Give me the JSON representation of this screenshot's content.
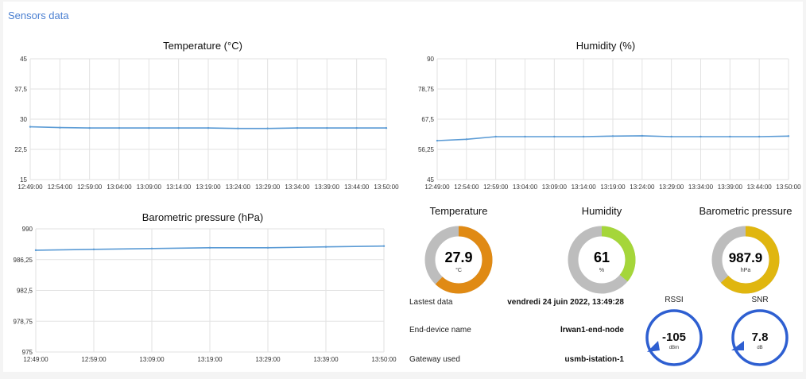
{
  "group_title": "Sensors data",
  "charts": {
    "temperature": {
      "title": "Temperature (°C)",
      "y_ticks": [
        "45",
        "37,5",
        "30",
        "22,5",
        "15"
      ],
      "x_ticks": [
        "12:49:00",
        "12:54:00",
        "12:59:00",
        "13:04:00",
        "13:09:00",
        "13:14:00",
        "13:19:00",
        "13:24:00",
        "13:29:00",
        "13:34:00",
        "13:39:00",
        "13:44:00",
        "13:50:00"
      ]
    },
    "humidity": {
      "title": "Humidity (%)",
      "y_ticks": [
        "90",
        "78,75",
        "67,5",
        "56,25",
        "45"
      ],
      "x_ticks": [
        "12:49:00",
        "12:54:00",
        "12:59:00",
        "13:04:00",
        "13:09:00",
        "13:14:00",
        "13:19:00",
        "13:24:00",
        "13:29:00",
        "13:34:00",
        "13:39:00",
        "13:44:00",
        "13:50:00"
      ]
    },
    "pressure": {
      "title": "Barometric pressure (hPa)",
      "y_ticks": [
        "990",
        "986,25",
        "982,5",
        "978,75",
        "975"
      ],
      "x_ticks": [
        "12:49:00",
        "12:59:00",
        "13:09:00",
        "13:19:00",
        "13:29:00",
        "13:39:00",
        "13:50:00"
      ]
    }
  },
  "gauges": {
    "temperature": {
      "title": "Temperature",
      "value": "27.9",
      "unit": "°C",
      "fraction": 0.62,
      "color": "#e08a14",
      "track": "#bdbdbd"
    },
    "humidity": {
      "title": "Humidity",
      "value": "61",
      "unit": "%",
      "fraction": 0.36,
      "color": "#a5d63a",
      "track": "#bdbdbd"
    },
    "pressure": {
      "title": "Barometric pressure",
      "value": "987.9",
      "unit": "hPa",
      "fraction": 0.63,
      "color": "#e0b60f",
      "track": "#bdbdbd"
    }
  },
  "info": {
    "last_data_label": "Lastest data",
    "last_data_value": "vendredi 24 juin 2022, 13:49:28",
    "device_label": "End-device name",
    "device_value": "lrwan1-end-node",
    "gateway_label": "Gateway used",
    "gateway_value": "usmb-istation-1"
  },
  "dials": {
    "rssi": {
      "title": "RSSI",
      "value": "-105",
      "unit": "dBm",
      "color": "#2e5fd1"
    },
    "snr": {
      "title": "SNR",
      "value": "7.8",
      "unit": "dB",
      "color": "#2e5fd1"
    }
  },
  "chart_data": [
    {
      "type": "line",
      "title": "Temperature (°C)",
      "x": [
        "12:49:00",
        "12:54:00",
        "12:59:00",
        "13:04:00",
        "13:09:00",
        "13:14:00",
        "13:19:00",
        "13:24:00",
        "13:29:00",
        "13:34:00",
        "13:39:00",
        "13:44:00",
        "13:50:00"
      ],
      "series": [
        {
          "values": [
            28.1,
            27.9,
            27.8,
            27.8,
            27.8,
            27.8,
            27.8,
            27.7,
            27.7,
            27.8,
            27.8,
            27.8,
            27.8
          ]
        }
      ],
      "ylim": [
        15,
        45
      ],
      "line_color": "#5b9bd5"
    },
    {
      "type": "line",
      "title": "Humidity (%)",
      "x": [
        "12:49:00",
        "12:54:00",
        "12:59:00",
        "13:04:00",
        "13:09:00",
        "13:14:00",
        "13:19:00",
        "13:24:00",
        "13:29:00",
        "13:34:00",
        "13:39:00",
        "13:44:00",
        "13:50:00"
      ],
      "series": [
        {
          "values": [
            59.5,
            60.0,
            61.0,
            61.0,
            61.0,
            61.0,
            61.2,
            61.3,
            61.0,
            61.0,
            61.0,
            61.0,
            61.2
          ]
        }
      ],
      "ylim": [
        45,
        90
      ],
      "line_color": "#5b9bd5"
    },
    {
      "type": "line",
      "title": "Barometric pressure (hPa)",
      "x": [
        "12:49:00",
        "12:59:00",
        "13:09:00",
        "13:19:00",
        "13:29:00",
        "13:39:00",
        "13:50:00"
      ],
      "series": [
        {
          "values": [
            987.4,
            987.5,
            987.6,
            987.7,
            987.7,
            987.8,
            987.9
          ]
        }
      ],
      "ylim": [
        975,
        990
      ],
      "line_color": "#5b9bd5"
    }
  ]
}
